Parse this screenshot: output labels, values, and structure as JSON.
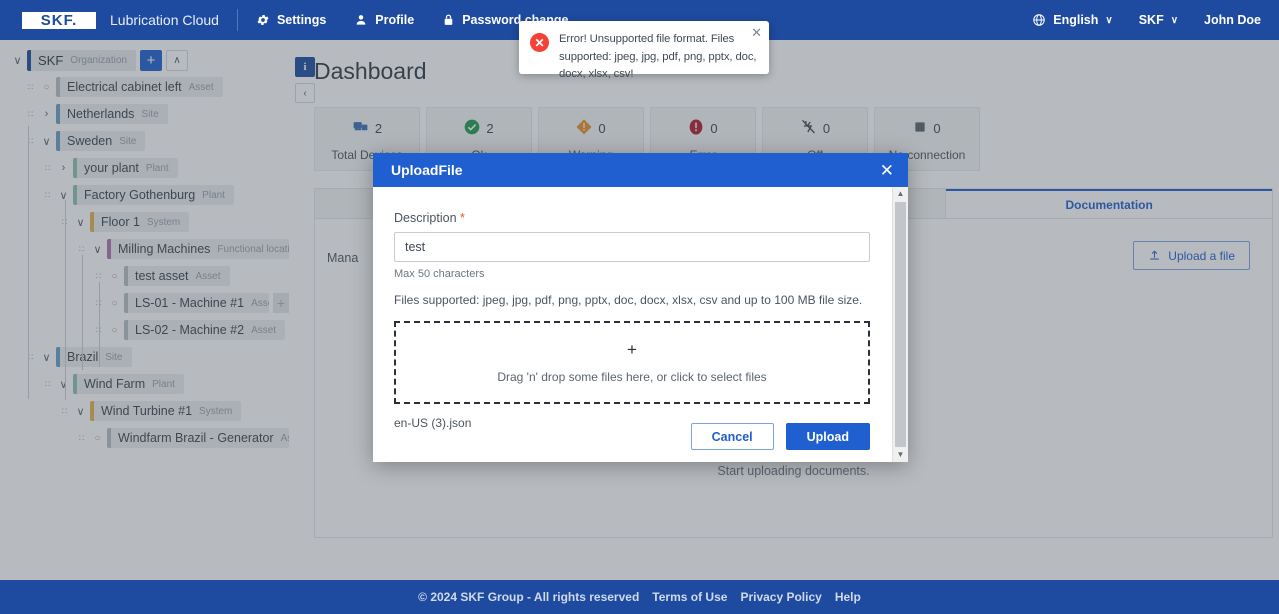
{
  "topbar": {
    "logo": "SKF.",
    "logo_icon": "skf-logo",
    "brand": "Lubrication Cloud",
    "nav": [
      {
        "label": "Settings",
        "icon": "gear-icon"
      },
      {
        "label": "Profile",
        "icon": "person-icon"
      },
      {
        "label": "Password change",
        "icon": "lock-icon"
      }
    ],
    "right": [
      {
        "label": "English",
        "icon": "globe-icon",
        "caret": "∨"
      },
      {
        "label": "SKF",
        "caret": "∨"
      },
      {
        "label": "John Doe"
      }
    ],
    "bg_color": "#1e4ba0"
  },
  "toast": {
    "icon": "error-circle-icon",
    "icon_glyph": "✕",
    "message": "Error! Unsupported file format. Files supported: jpeg, jpg, pdf, png, pptx, doc, docx, xlsx, csv!",
    "close_glyph": "✕",
    "color": "#f44336"
  },
  "sidebar": {
    "root": {
      "name": "SKF",
      "type": "Organization",
      "toggle": "∨",
      "add_label": "+",
      "collapse_label": "∧"
    },
    "info_label": "i",
    "panel_toggle": "‹",
    "nodes": [
      {
        "name": "Electrical cabinet left",
        "type": "Asset",
        "depth": 1,
        "toggle": "dot",
        "color": "#b9bec4"
      },
      {
        "name": "Netherlands",
        "type": "Site",
        "depth": 1,
        "toggle": "›",
        "color": "#6a9fc8"
      },
      {
        "name": "Sweden",
        "type": "Site",
        "depth": 1,
        "toggle": "∨",
        "color": "#6a9fc8"
      },
      {
        "name": "your plant",
        "type": "Plant",
        "depth": 2,
        "toggle": "›",
        "color": "#8fc2ad"
      },
      {
        "name": "Factory Gothenburg",
        "type": "Plant",
        "depth": 2,
        "toggle": "∨",
        "color": "#8fc2ad"
      },
      {
        "name": "Floor 1",
        "type": "System",
        "depth": 3,
        "toggle": "∨",
        "color": "#e4b košt"
      },
      {
        "name": "Milling Machines",
        "type": "Functional location",
        "depth": 4,
        "toggle": "∨",
        "color": "#ab74ab"
      },
      {
        "name": "test asset",
        "type": "Asset",
        "depth": 5,
        "toggle": "dot",
        "color": "#b9bec4"
      },
      {
        "name": "LS-01 - Machine #1",
        "type": "Asset",
        "depth": 5,
        "toggle": "dot",
        "color": "#b9bec4",
        "kebab": "⋮",
        "quick_add": "+"
      },
      {
        "name": "LS-02 - Machine #2",
        "type": "Asset",
        "depth": 5,
        "toggle": "dot",
        "color": "#b9bec4"
      },
      {
        "name": "Brazil",
        "type": "Site",
        "depth": 1,
        "toggle": "∨",
        "color": "#6a9fc8"
      },
      {
        "name": "Wind Farm",
        "type": "Plant",
        "depth": 2,
        "toggle": "∨",
        "color": "#8fc2ad"
      },
      {
        "name": "Wind Turbine #1",
        "type": "System",
        "depth": 3,
        "toggle": "∨",
        "color": "#e4b352"
      },
      {
        "name": "Windfarm Brazil - Generator",
        "type": "Asset",
        "depth": 4,
        "toggle": "dot",
        "color": "#b9bec4"
      }
    ]
  },
  "page": {
    "title": "Dashboard"
  },
  "stats": [
    {
      "label": "Total Devices",
      "value": "2",
      "icon": "devices-icon",
      "color": "#3a6eb5"
    },
    {
      "label": "Ok",
      "value": "2",
      "icon": "check-circle-icon",
      "color": "#1f9d4d"
    },
    {
      "label": "Warning",
      "value": "0",
      "icon": "warning-diamond-icon",
      "color": "#e8912a"
    },
    {
      "label": "Error",
      "value": "0",
      "icon": "error-circle-icon",
      "color": "#b01c2e"
    },
    {
      "label": "Off",
      "value": "0",
      "icon": "plug-off-icon",
      "color": "#3d4752"
    },
    {
      "label": "No connection",
      "value": "0",
      "icon": "square-icon",
      "color": "#5a646e"
    }
  ],
  "panel": {
    "tabs": [
      {
        "label": "",
        "active": false
      },
      {
        "label": "",
        "active": false
      },
      {
        "label": "",
        "active": false
      },
      {
        "label": "",
        "active": false
      },
      {
        "label": "",
        "active": false
      },
      {
        "label": "Documentation",
        "active": true
      }
    ],
    "manage_label": "Mana",
    "upload_button": {
      "label": "Upload a file",
      "icon": "upload-icon"
    },
    "empty_message": "Start uploading documents."
  },
  "modal": {
    "title": "UploadFile",
    "close_glyph": "✕",
    "description_label": "Description",
    "required_marker": "*",
    "description_value": "test",
    "description_placeholder": "",
    "max_chars_hint": "Max 50 characters",
    "supported_text": "Files supported: jpeg, jpg, pdf, png, pptx, doc, docx, xlsx, csv and up to 100 MB file size.",
    "dropzone_plus": "+",
    "dropzone_text": "Drag 'n' drop some files here, or click to select files",
    "selected_file": "en-US (3).json",
    "cancel_label": "Cancel",
    "upload_label": "Upload",
    "scroll_up": "▲",
    "scroll_down": "▼",
    "accent_color": "#1f5fd0"
  },
  "footer": {
    "copyright": "© 2024 SKF Group - All rights reserved",
    "links": [
      "Terms of Use",
      "Privacy Policy",
      "Help"
    ]
  }
}
